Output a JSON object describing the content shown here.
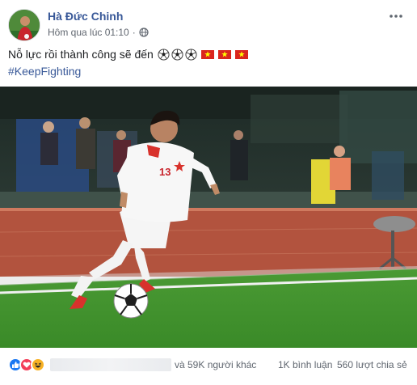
{
  "post": {
    "author": "Hà Đức Chinh",
    "timestamp": "Hôm qua lúc 01:10",
    "separator": "·",
    "privacy_icon": "globe-icon",
    "more_icon": "more-horizontal-icon",
    "text": "Nỗ lực rồi thành công sẽ đến",
    "emoji": [
      "soccer-ball-icon",
      "soccer-ball-icon",
      "soccer-ball-icon",
      "vietnam-flag-icon",
      "vietnam-flag-icon",
      "vietnam-flag-icon"
    ],
    "hashtag": "#KeepFighting",
    "photo_alt": "Cầu thủ số 13 dẫn bóng trên sân"
  },
  "photo": {
    "jersey_number": "13"
  },
  "footer": {
    "reaction_icons": [
      "like-icon",
      "love-icon",
      "haha-icon"
    ],
    "others_text": "và 59K người khác",
    "comments_text": "1K bình luận",
    "shares_text": "560 lượt chia sẻ"
  },
  "colors": {
    "link_blue": "#385898",
    "secondary_text": "#616770",
    "flag_red": "#da251d",
    "flag_star": "#ffff00",
    "pitch_green": "#3f8f2c",
    "track_red": "#b2533e"
  }
}
